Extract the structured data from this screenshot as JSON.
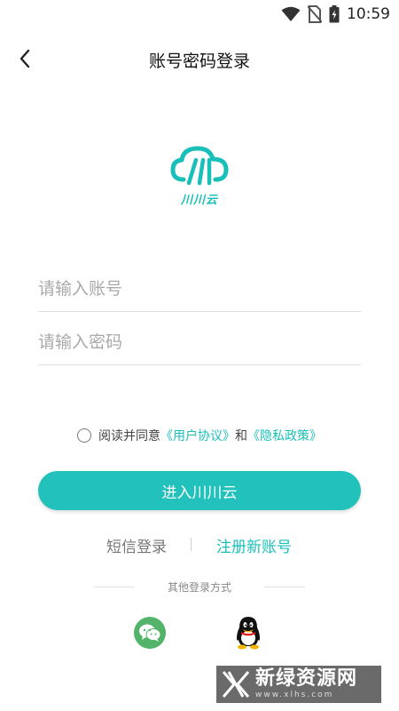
{
  "status_bar": {
    "time": "10:59"
  },
  "nav": {
    "title": "账号密码登录"
  },
  "logo": {
    "text": "川川云"
  },
  "form": {
    "account_placeholder": "请输入账号",
    "password_placeholder": "请输入密码"
  },
  "agreement": {
    "prefix": "阅读并同意",
    "user_agreement": "《用户协议》",
    "and": "和",
    "privacy_policy": "《隐私政策》"
  },
  "login_button": "进入川川云",
  "alt": {
    "sms_login": "短信登录",
    "register": "注册新账号"
  },
  "other_login": {
    "label": "其他登录方式",
    "methods": [
      "wechat-icon",
      "qq-icon"
    ]
  },
  "watermark": {
    "main": "新绿资源网",
    "sub": "www.xlhs.com"
  },
  "colors": {
    "accent": "#22c1bb",
    "wechat": "#53b36a"
  }
}
